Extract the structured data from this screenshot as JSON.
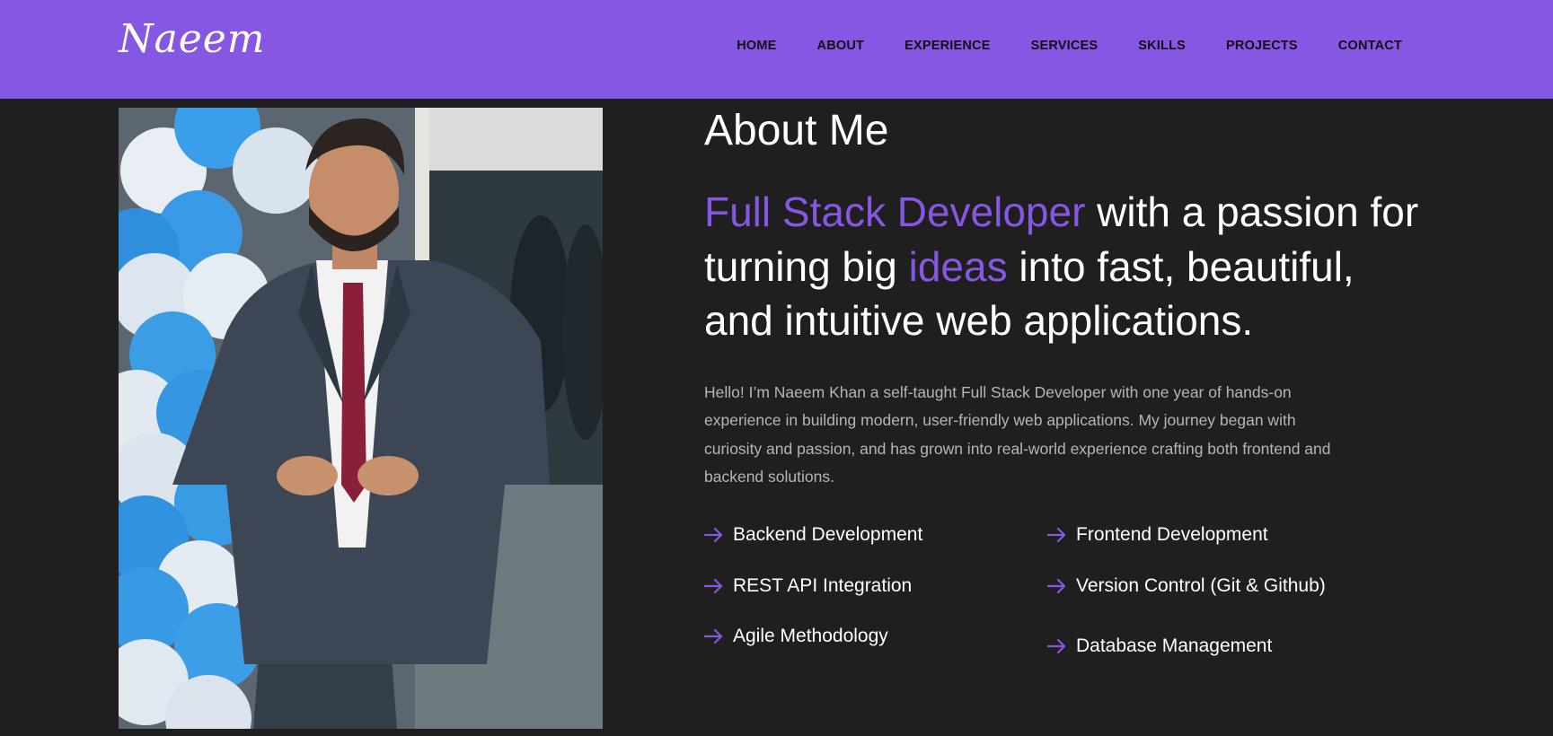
{
  "brand": {
    "logo_text": "Naeem"
  },
  "nav": {
    "items": [
      {
        "label": "HOME"
      },
      {
        "label": "ABOUT"
      },
      {
        "label": "EXPERIENCE"
      },
      {
        "label": "SERVICES"
      },
      {
        "label": "SKILLS"
      },
      {
        "label": "PROJECTS"
      },
      {
        "label": "CONTACT"
      }
    ]
  },
  "about": {
    "title": "About Me",
    "headline": {
      "part1": "Full Stack Developer",
      "part2": " with a passion for turning big ",
      "part3": "ideas",
      "part4": " into fast, beautiful, and intuitive web applications."
    },
    "intro": "Hello! I’m Naeem Khan a self-taught Full Stack Developer with one year of hands-on experience in building modern, user-friendly web applications. My journey began with curiosity and passion, and has grown into real-world experience crafting both frontend and backend solutions.",
    "skills": [
      {
        "label": "Backend Development"
      },
      {
        "label": "Frontend Development"
      },
      {
        "label": "REST API Integration"
      },
      {
        "label": "Version Control (Git & Github)"
      },
      {
        "label": "Agile Methodology"
      },
      {
        "label": "Database Management"
      }
    ]
  },
  "colors": {
    "accent": "#8657e2",
    "page_background": "#1f1f1f",
    "nav_background": "#8657e2",
    "body_text": "#b5b5b5",
    "heading_text": "#ffffff"
  },
  "icons": {
    "skill_bullet": "arrow-right-icon"
  }
}
